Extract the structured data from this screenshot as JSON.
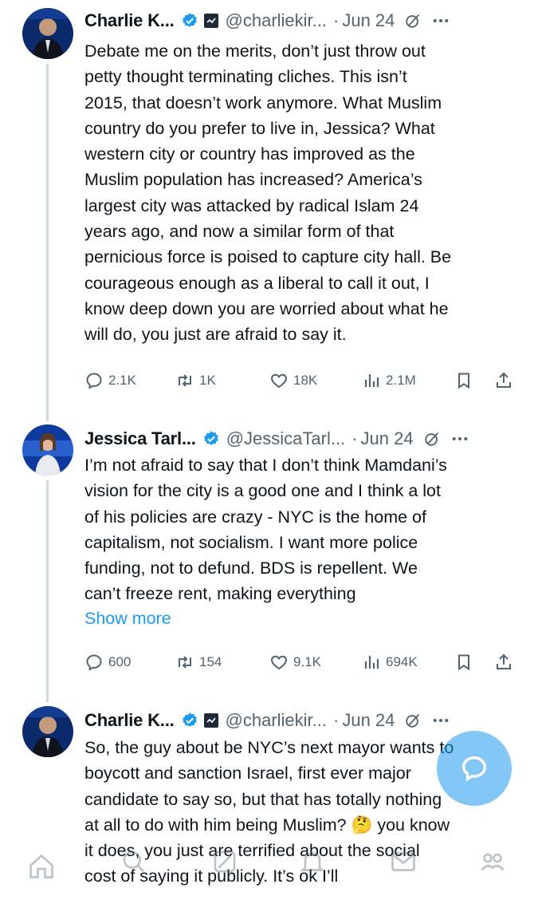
{
  "colors": {
    "text": "#0f1419",
    "secondary": "#536471",
    "accent": "#1d9bf0",
    "thread_line": "#cfd9de"
  },
  "tweets": [
    {
      "name": "Charlie K...",
      "handle": "@charliekir...",
      "separator": "·",
      "date": "Jun 24",
      "verified": true,
      "affiliate_badge": true,
      "body_lines": [
        "Debate me on the merits, don’t just throw out",
        "petty thought terminating cliches. This isn’t",
        "2015, that doesn’t work anymore. What Muslim",
        "country do you prefer to live in, Jessica? What",
        "western city or country has improved as the",
        "Muslim population has increased? America’s",
        "largest city was attacked by radical Islam 24",
        "years ago, and now a similar form of that",
        "pernicious force is poised to capture city hall. Be",
        "courageous enough as a liberal to call it out, I",
        "know deep down you are worried about what he",
        "will do, you just are afraid to say it."
      ],
      "show_more": "",
      "stats": {
        "replies": "2.1K",
        "reposts": "1K",
        "likes": "18K",
        "views": "2.1M"
      }
    },
    {
      "name": "Jessica Tarl...",
      "handle": "@JessicaTarl...",
      "separator": "·",
      "date": "Jun 24",
      "verified": true,
      "affiliate_badge": false,
      "body_lines": [
        "I’m not afraid to say that I don’t think Mamdani’s",
        "vision for the city is a good one and I think a lot",
        "of his policies are crazy - NYC is the home of",
        "capitalism, not socialism. I want more police",
        "funding, not to defund. BDS is repellent. We",
        "can’t freeze rent, making everything"
      ],
      "show_more": "Show more",
      "stats": {
        "replies": "600",
        "reposts": "154",
        "likes": "9.1K",
        "views": "694K"
      }
    },
    {
      "name": "Charlie K...",
      "handle": "@charliekir...",
      "separator": "·",
      "date": "Jun 24",
      "verified": true,
      "affiliate_badge": true,
      "body_lines": [
        "So, the guy about be NYC’s next mayor wants to",
        "boycott and sanction Israel, first ever major",
        "candidate to say so, but that has totally nothing",
        "at all to do with him being Muslim? 🤔 you know",
        "it does, you just are terrified about the social",
        "cost of saying it publicly. It’s ok I’ll"
      ],
      "show_more": "",
      "stats": null
    }
  ],
  "icons": {
    "reply": "reply-icon",
    "repost": "repost-icon",
    "like": "heart-icon",
    "views": "views-icon",
    "bookmark": "bookmark-icon",
    "share": "share-icon",
    "grok": "grok-icon",
    "more": "more-icon",
    "compose": "compose-icon"
  },
  "bottom_nav": [
    "home-icon",
    "search-icon",
    "grok-icon",
    "notifications-icon",
    "messages-icon",
    "communities-icon"
  ]
}
